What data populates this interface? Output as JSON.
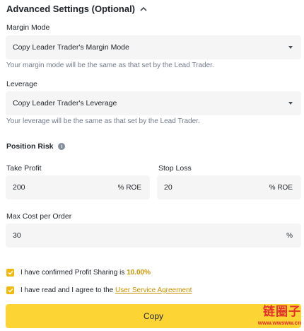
{
  "advanced": {
    "title": "Advanced Settings (Optional)"
  },
  "margin_mode": {
    "label": "Margin Mode",
    "selected": "Copy Leader Trader's Margin Mode",
    "hint": "Your margin mode will be the same as that set by the Lead Trader."
  },
  "leverage": {
    "label": "Leverage",
    "selected": "Copy Leader Trader's Leverage",
    "hint": "Your leverage will be the same as that set by the Lead Trader."
  },
  "position_risk": {
    "label": "Position Risk",
    "take_profit": {
      "label": "Take Profit",
      "value": "200",
      "unit": "% ROE"
    },
    "stop_loss": {
      "label": "Stop Loss",
      "value": "20",
      "unit": "% ROE"
    }
  },
  "max_cost": {
    "label": "Max Cost per Order",
    "value": "30",
    "unit": "%"
  },
  "agreements": {
    "profit_sharing_prefix": "I have confirmed Profit Sharing is ",
    "profit_sharing_value": "10.00%",
    "terms_prefix": "I have read and I agree to the ",
    "terms_link": "User Service Agreement",
    "profit_sharing_checked": true,
    "terms_checked": true
  },
  "copy_button": {
    "label": "Copy"
  },
  "watermark": {
    "main": "链圈子",
    "sub": "www.wwsww.cn"
  },
  "colors": {
    "brand": "#fcd535",
    "accent": "#c99400",
    "checkbox": "#f0b90b",
    "watermark": "#e3302b"
  }
}
